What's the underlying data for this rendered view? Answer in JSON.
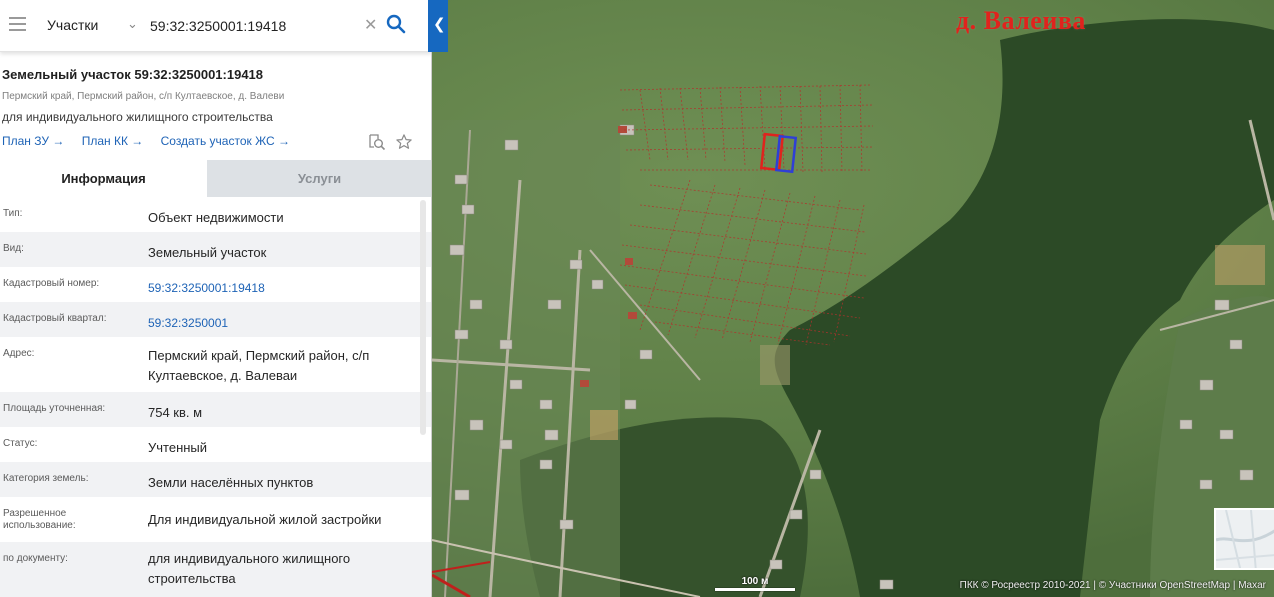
{
  "search": {
    "layer": "Участки",
    "query": "59:32:3250001:19418"
  },
  "parcel": {
    "title": "Земельный участок 59:32:3250001:19418",
    "address": "Пермский край, Пермский район, с/п Култаевское, д. Валеви",
    "purpose": "для индивидуального жилищного строительства",
    "links": [
      "План ЗУ →",
      "План КК →",
      "Создать участок ЖС →"
    ]
  },
  "tabs": [
    "Информация",
    "Услуги"
  ],
  "rows": [
    {
      "label": "Тип:",
      "value": "Объект недвижимости",
      "link": false
    },
    {
      "label": "Вид:",
      "value": "Земельный участок",
      "link": false
    },
    {
      "label": "Кадастровый номер:",
      "value": "59:32:3250001:19418",
      "link": true
    },
    {
      "label": "Кадастровый квартал:",
      "value": "59:32:3250001",
      "link": true
    },
    {
      "label": "Адрес:",
      "value": "Пермский край, Пермский район, с/п Култаевское, д. Валеваи",
      "link": false
    },
    {
      "label": "Площадь уточненная:",
      "value": "754 кв. м",
      "link": false
    },
    {
      "label": "Статус:",
      "value": "Учтенный",
      "link": false
    },
    {
      "label": "Категория земель:",
      "value": "Земли населённых пунктов",
      "link": false
    },
    {
      "label": "Разрешенное использование:",
      "value": "Для индивидуальной жилой застройки",
      "link": false
    },
    {
      "label": "по документу:",
      "value": "для индивидуального жилищного строительства",
      "link": false
    }
  ],
  "map": {
    "place_label": "д. Валеива",
    "scale_label": "100 м",
    "attribution": "ПКК © Росреестр 2010-2021 | © Участники OpenStreetMap | Maxar"
  },
  "colors": {
    "accent": "#1668c0",
    "link": "#1e63b6",
    "selected_parcel": "#e0231d",
    "neighbor_parcel": "#2f3fd6"
  },
  "icons": {
    "menu": "burger-menu-icon",
    "dropdown": "chevron-down-icon",
    "clear": "close-icon",
    "search": "search-icon",
    "collapse": "chevron-left-icon",
    "zoom_to": "zoom-to-object-icon",
    "favorite": "star-icon"
  }
}
